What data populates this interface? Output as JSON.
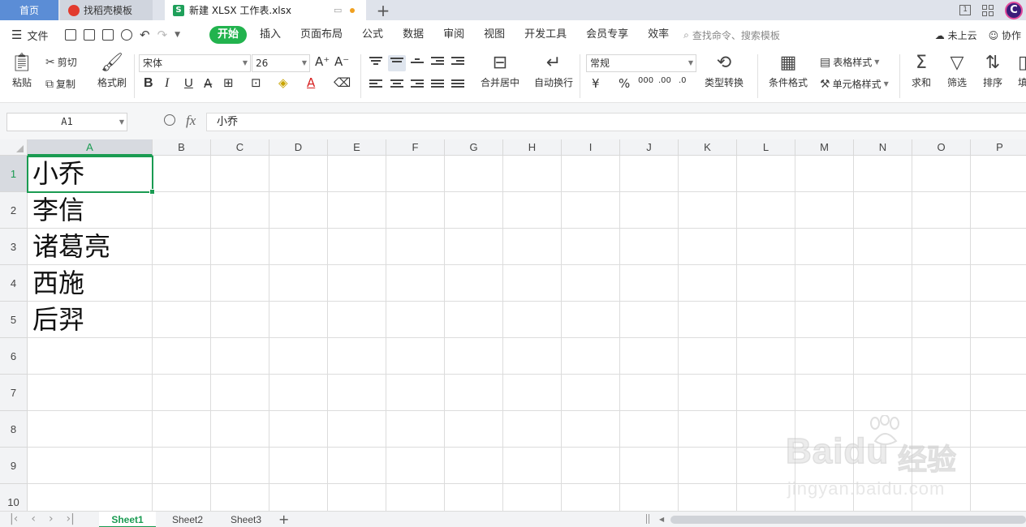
{
  "tabs": {
    "home": "首页",
    "template": "找稻壳模板",
    "document": "新建 XLSX 工作表.xlsx",
    "add": "+"
  },
  "window": {
    "layout_badge": "1"
  },
  "menu": {
    "file": "文件",
    "items": [
      "开始",
      "插入",
      "页面布局",
      "公式",
      "数据",
      "审阅",
      "视图",
      "开发工具",
      "会员专享",
      "效率"
    ],
    "search_placeholder": "查找命令、搜索模板",
    "cloud": "未上云",
    "collab": "协作"
  },
  "ribbon": {
    "paste": "粘贴",
    "cut": "剪切",
    "copy": "复制",
    "format_painter": "格式刷",
    "font_name": "宋体",
    "font_size": "26",
    "merge_center": "合并居中",
    "wrap_text": "自动换行",
    "number_format": "常规",
    "type_convert": "类型转换",
    "conditional_format": "条件格式",
    "table_style": "表格样式",
    "cell_style": "单元格样式",
    "sum": "求和",
    "filter": "筛选",
    "sort": "排序",
    "fill": "填",
    "currency_symbol": "¥",
    "percent_symbol": "%"
  },
  "formula_bar": {
    "name_box": "A1",
    "fx": "fx",
    "content": "小乔"
  },
  "sheet": {
    "columns": [
      "A",
      "B",
      "C",
      "D",
      "E",
      "F",
      "G",
      "H",
      "I",
      "J",
      "K",
      "L",
      "M",
      "N",
      "O",
      "P"
    ],
    "rows": [
      "1",
      "2",
      "3",
      "4",
      "5",
      "6",
      "7",
      "8",
      "9",
      "10"
    ],
    "cells_A": [
      "小乔",
      "李信",
      "诸葛亮",
      "西施",
      "后羿",
      "",
      "",
      "",
      "",
      ""
    ],
    "selected_cell": "A1"
  },
  "sheet_tabs": [
    "Sheet1",
    "Sheet2",
    "Sheet3"
  ],
  "watermark": {
    "logo": "Baidu",
    "cn": "经验",
    "url": "jingyan.baidu.com"
  },
  "colors": {
    "accent": "#1a9b52",
    "active_menu": "#22b34e",
    "home_tab": "#5b8dd6"
  }
}
